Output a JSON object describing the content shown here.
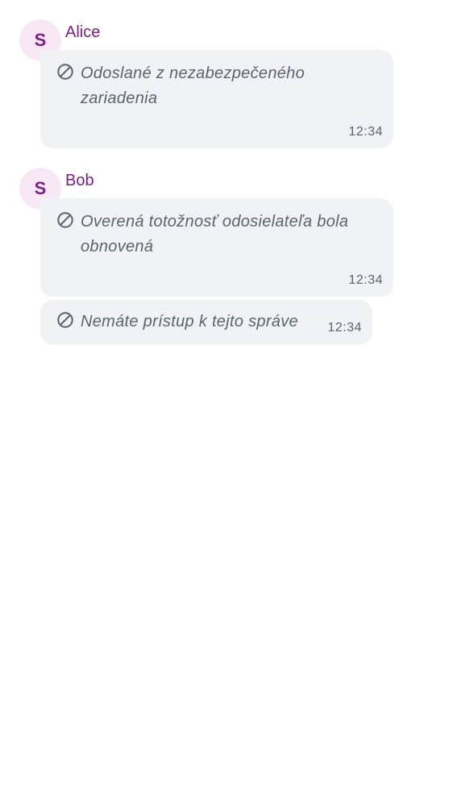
{
  "timeline": {
    "groups": [
      {
        "avatar_letter": "S",
        "sender": "Alice",
        "messages": [
          {
            "line1": "Odoslané z nezabezpečeného",
            "line2": "zariadenia",
            "time": "12:34",
            "icon": "blocked-icon"
          }
        ]
      },
      {
        "avatar_letter": "S",
        "sender": "Bob",
        "messages": [
          {
            "line1": "Overená totožnosť odosielateľa bola",
            "line2": "obnovená",
            "time": "12:34",
            "icon": "blocked-icon"
          },
          {
            "line1": "Nemáte prístup k tejto správe",
            "time": "12:34",
            "icon": "blocked-icon"
          }
        ]
      }
    ]
  },
  "colors": {
    "sender": "#7b1f8a",
    "avatar_bg": "#f8e8f6",
    "bubble_bg": "#f0f2f5",
    "muted_text": "#5c6470"
  }
}
